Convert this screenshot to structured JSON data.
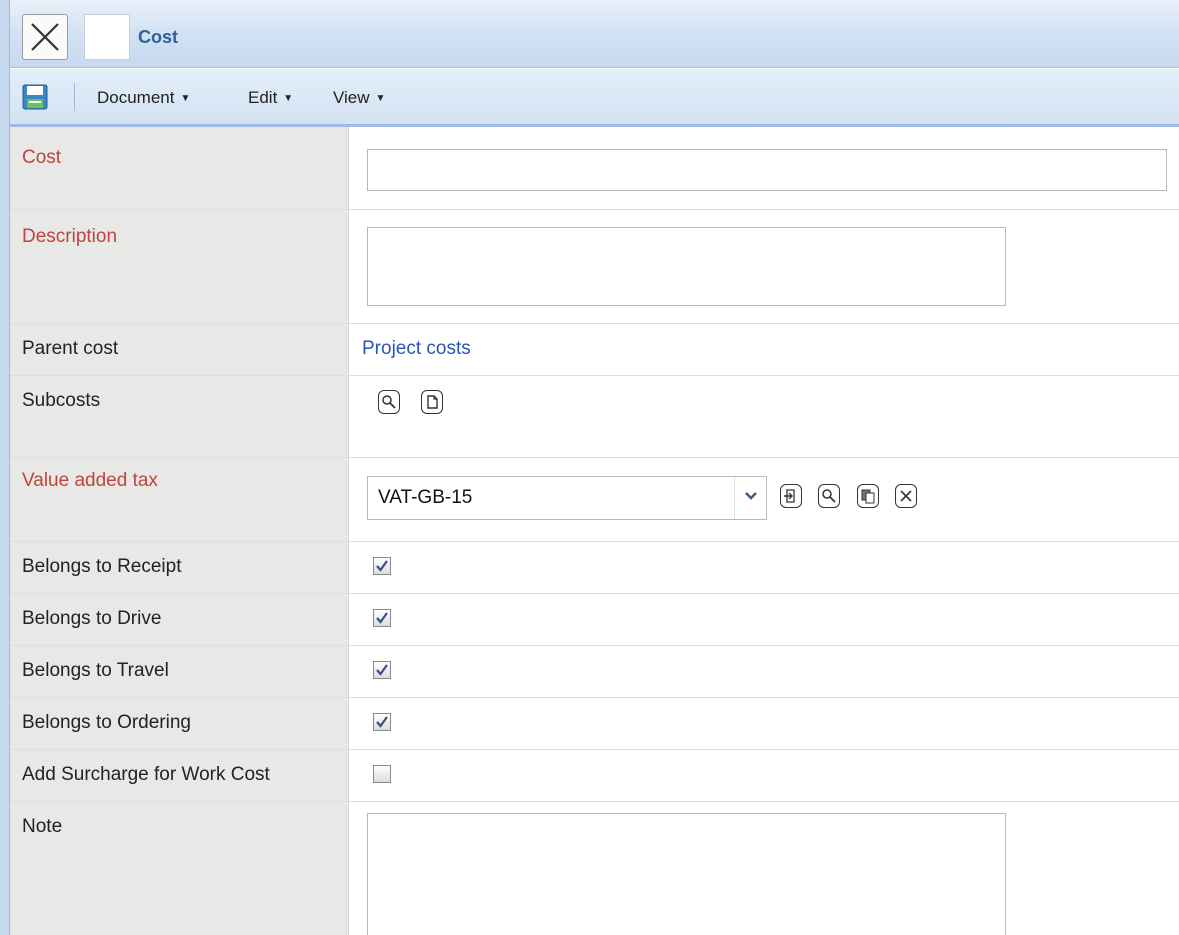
{
  "window": {
    "title": "Cost"
  },
  "toolbar": {
    "menus": [
      {
        "label": "Document"
      },
      {
        "label": "Edit"
      },
      {
        "label": "View"
      }
    ]
  },
  "form": {
    "cost": {
      "label": "Cost",
      "value": ""
    },
    "description": {
      "label": "Description",
      "value": ""
    },
    "parent_cost": {
      "label": "Parent cost",
      "value": "Project costs"
    },
    "subcosts": {
      "label": "Subcosts"
    },
    "vat": {
      "label": "Value added tax",
      "value": "VAT-GB-15"
    },
    "belongs_receipt": {
      "label": "Belongs to Receipt",
      "checked": true
    },
    "belongs_drive": {
      "label": "Belongs to Drive",
      "checked": true
    },
    "belongs_travel": {
      "label": "Belongs to Travel",
      "checked": true
    },
    "belongs_ordering": {
      "label": "Belongs to Ordering",
      "checked": true
    },
    "add_surcharge": {
      "label": "Add Surcharge for Work Cost",
      "checked": false
    },
    "note": {
      "label": "Note",
      "value": ""
    }
  },
  "colors": {
    "required_label": "#c0453c",
    "link": "#2a55b8",
    "title": "#2f5f9c",
    "label_column": "#e8e8e6"
  },
  "icons": [
    "close-icon",
    "save-icon",
    "search-icon",
    "new-document-icon",
    "open-reference-icon",
    "copy-icon",
    "clear-icon",
    "dropdown-arrow-icon",
    "checkmark-icon"
  ]
}
